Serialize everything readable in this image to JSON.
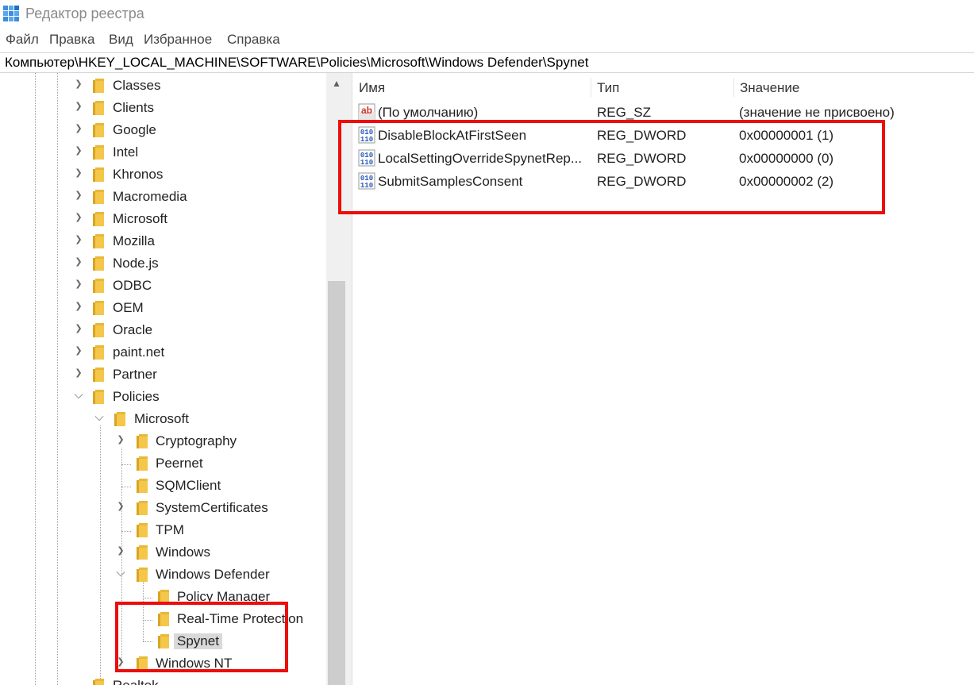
{
  "window": {
    "title": "Редактор реестра"
  },
  "menu": [
    "Файл",
    "Правка",
    "Вид",
    "Избранное",
    "Справка"
  ],
  "address": "Компьютер\\HKEY_LOCAL_MACHINE\\SOFTWARE\\Policies\\Microsoft\\Windows Defender\\Spynet",
  "tree": {
    "software_children": [
      "Classes",
      "Clients",
      "Google",
      "Intel",
      "Khronos",
      "Macromedia",
      "Microsoft",
      "Mozilla",
      "Node.js",
      "ODBC",
      "OEM",
      "Oracle",
      "paint.net",
      "Partner"
    ],
    "policies": "Policies",
    "policies_microsoft": "Microsoft",
    "microsoft_children": [
      "Cryptography",
      "Peernet",
      "SQMClient",
      "SystemCertificates",
      "TPM",
      "Windows"
    ],
    "windows_defender": "Windows Defender",
    "defender_children": [
      "Policy Manager",
      "Real-Time Protection",
      "Spynet"
    ],
    "selected": "Spynet",
    "windows_nt": "Windows NT",
    "partial_next": "Realtek"
  },
  "list": {
    "headers": {
      "name": "Имя",
      "type": "Тип",
      "value": "Значение"
    },
    "rows": [
      {
        "icon": "string-value-icon",
        "name": "(По умолчанию)",
        "type": "REG_SZ",
        "value": "(значение не присвоено)"
      },
      {
        "icon": "dword-value-icon",
        "name": "DisableBlockAtFirstSeen",
        "type": "REG_DWORD",
        "value": "0x00000001 (1)"
      },
      {
        "icon": "dword-value-icon",
        "name": "LocalSettingOverrideSpynetRep...",
        "type": "REG_DWORD",
        "value": "0x00000000 (0)"
      },
      {
        "icon": "dword-value-icon",
        "name": "SubmitSamplesConsent",
        "type": "REG_DWORD",
        "value": "0x00000002 (2)"
      }
    ]
  },
  "colors": {
    "highlight_box": "#ec0d0d",
    "selection": "#d9d9d9",
    "folder": "#f4c64a"
  }
}
